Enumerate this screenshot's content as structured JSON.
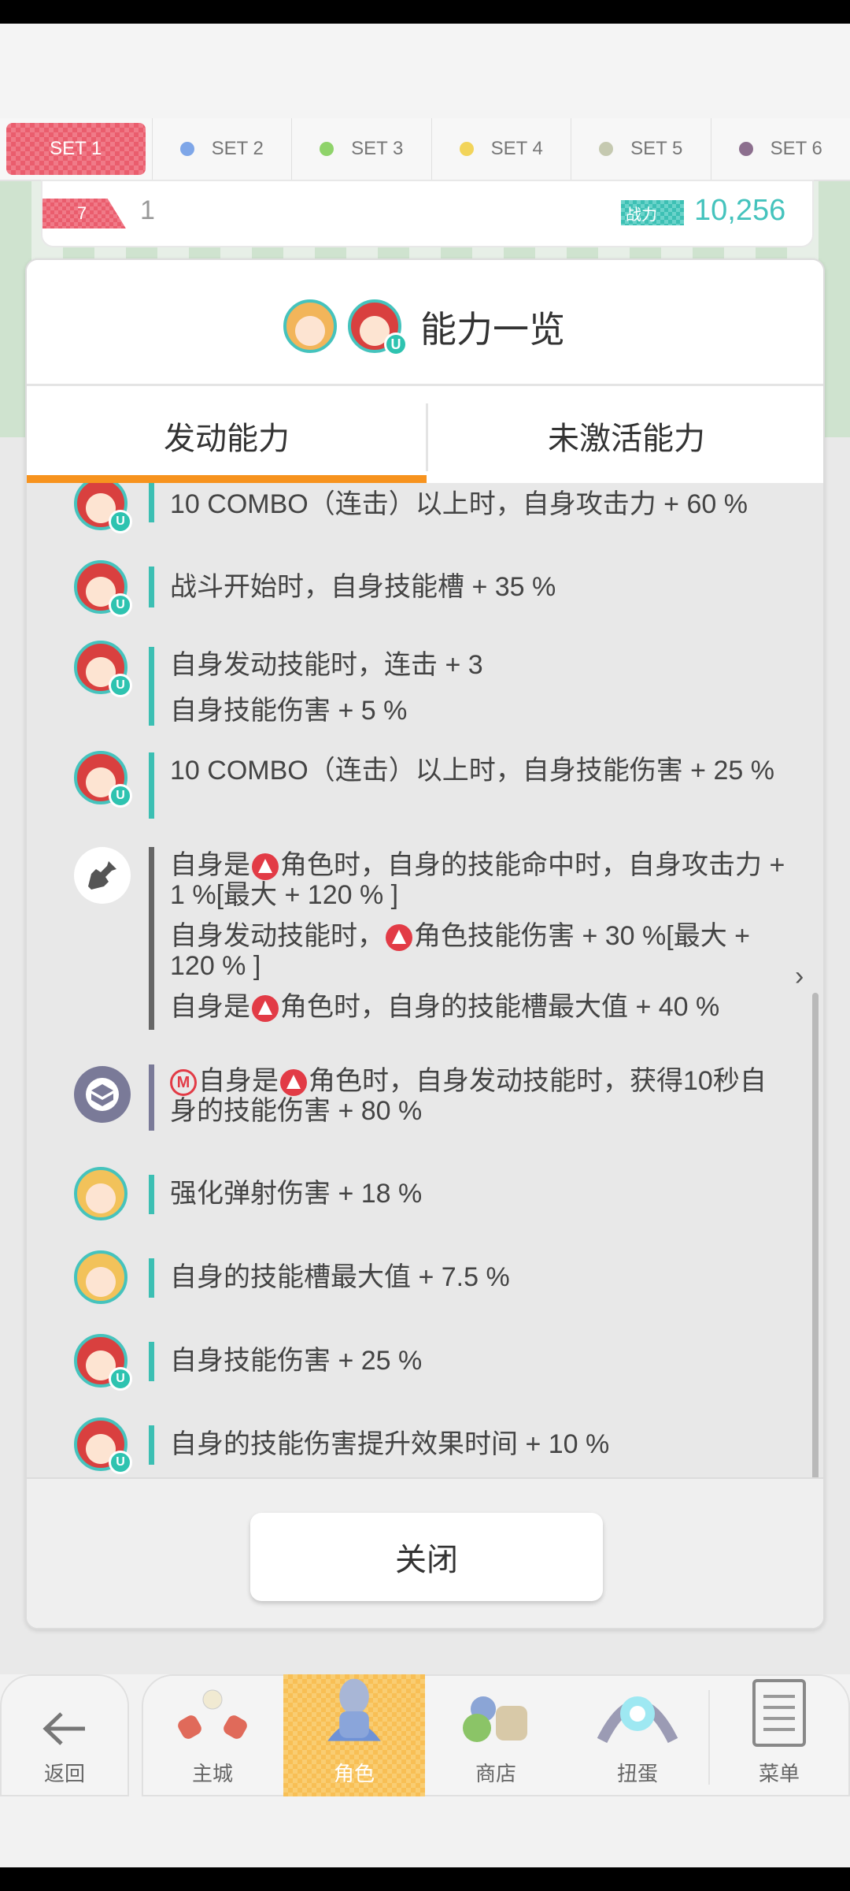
{
  "set_tabs": [
    {
      "label": "SET 1",
      "dot": ""
    },
    {
      "label": "SET 2",
      "dot": "#7ea6e8"
    },
    {
      "label": "SET 3",
      "dot": "#8fd36a"
    },
    {
      "label": "SET 4",
      "dot": "#f2d45a"
    },
    {
      "label": "SET 5",
      "dot": "#c5c9b0"
    },
    {
      "label": "SET 6",
      "dot": "#8c6f8e"
    }
  ],
  "info": {
    "level_tag": "7",
    "level_value": "1",
    "power_tag": "战力",
    "power_value": "10,256"
  },
  "modal": {
    "title": "能力一览",
    "tabs": [
      "发动能力",
      "未激活能力"
    ],
    "close_label": "关闭"
  },
  "abilities": [
    {
      "lines": [
        "10 COMBO（连击）以上时，自身攻击力 + 60 %"
      ]
    },
    {
      "lines": [
        "战斗开始时，自身技能槽 + 35 %"
      ]
    },
    {
      "lines": [
        "自身发动技能时，连击 + 3",
        "自身技能伤害 + 5 %"
      ]
    },
    {
      "lines": [
        "10 COMBO（连击）以上时，自身技能伤害 + 25 %"
      ]
    },
    {
      "lines": [
        {
          "pre": "自身是",
          "post": "角色时，自身的技能命中时，自身攻击力 + 1 %[最大 + 120 % ]"
        },
        {
          "pre": "自身发动技能时，",
          "post": "角色技能伤害 + 30 %[最大 + 120 % ]"
        },
        {
          "pre": "自身是",
          "post": "角色时，自身的技能槽最大值 + 40 %"
        }
      ]
    },
    {
      "lines": [
        {
          "mark": "M",
          "pre": "自身是",
          "post": "角色时，自身发动技能时，获得10秒自身的技能伤害 + 80 %"
        }
      ]
    },
    {
      "lines": [
        "强化弹射伤害 + 18 %"
      ]
    },
    {
      "lines": [
        "自身的技能槽最大值 + 7.5 %"
      ]
    },
    {
      "lines": [
        "自身技能伤害 + 25 %"
      ]
    },
    {
      "lines": [
        "自身的技能伤害提升效果时间 + 10 %"
      ]
    }
  ],
  "badge": "U",
  "nav": [
    "返回",
    "主城",
    "角色",
    "商店",
    "扭蛋",
    "菜单"
  ],
  "colors": {
    "accent_teal": "#3cbfb3",
    "tab_underline": "#f7931e",
    "element_red": "#e23b46"
  }
}
